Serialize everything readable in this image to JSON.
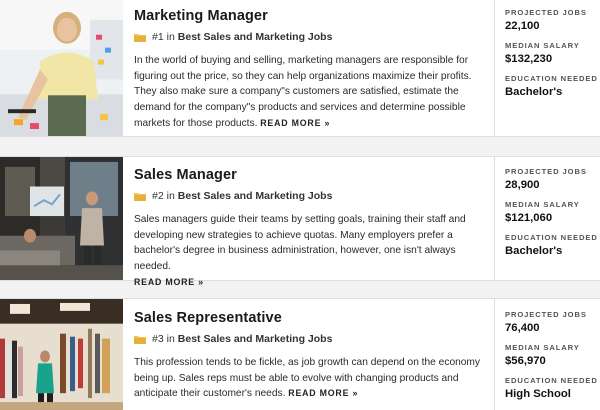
{
  "colors": {
    "folder": "#f2c14e",
    "border": "#dedede",
    "background": "#f2f2f2"
  },
  "jobs": [
    {
      "title": "Marketing Manager",
      "rank": "#1",
      "rank_in": "in",
      "category": "Best Sales and Marketing Jobs",
      "description": "In the world of buying and selling, marketing managers are responsible for figuring out the price, so they can help organizations maximize their profits. They also make sure a company\"s customers are satisfied, estimate the demand for the company\"s products and services and determine possible markets for those products.",
      "read_more": "READ MORE »",
      "stats": [
        {
          "label": "PROJECTED JOBS",
          "value": "22,100"
        },
        {
          "label": "MEDIAN SALARY",
          "value": "$132,230"
        },
        {
          "label": "EDUCATION NEEDED",
          "value": "Bachelor's"
        }
      ]
    },
    {
      "title": "Sales Manager",
      "rank": "#2",
      "rank_in": "in",
      "category": "Best Sales and Marketing Jobs",
      "description": "Sales managers guide their teams by setting goals, training their staff and developing new strategies to achieve quotas. Many employers prefer a bachelor's degree in business administration, however, one isn't always needed.",
      "read_more": "READ MORE »",
      "stats": [
        {
          "label": "PROJECTED JOBS",
          "value": "28,900"
        },
        {
          "label": "MEDIAN SALARY",
          "value": "$121,060"
        },
        {
          "label": "EDUCATION NEEDED",
          "value": "Bachelor's"
        }
      ]
    },
    {
      "title": "Sales Representative",
      "rank": "#3",
      "rank_in": "in",
      "category": "Best Sales and Marketing Jobs",
      "description": "This profession tends to be fickle, as job growth can depend on the economy being up. Sales reps must be able to evolve with changing products and anticipate their customer's needs.",
      "read_more": "READ MORE »",
      "stats": [
        {
          "label": "PROJECTED JOBS",
          "value": "76,400"
        },
        {
          "label": "MEDIAN SALARY",
          "value": "$56,970"
        },
        {
          "label": "EDUCATION NEEDED",
          "value": "High School"
        }
      ]
    }
  ]
}
